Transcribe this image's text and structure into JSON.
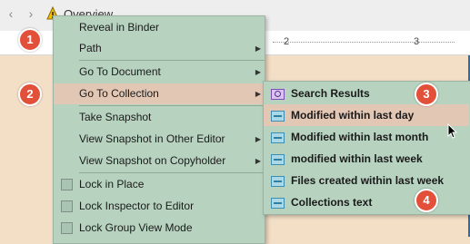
{
  "toolbar": {
    "back_glyph": "‹",
    "forward_glyph": "›",
    "document_title": "Overview"
  },
  "ruler": {
    "marks": [
      "2",
      "3"
    ]
  },
  "context_menu": {
    "items": [
      {
        "label": "Reveal in Binder"
      },
      {
        "label": "Path",
        "submenu": true
      },
      {
        "label": "Go To Document",
        "submenu": true
      },
      {
        "label": "Go To Collection",
        "submenu": true,
        "highlighted": true
      },
      {
        "label": "Take Snapshot"
      },
      {
        "label": "View Snapshot in Other Editor",
        "submenu": true
      },
      {
        "label": "View Snapshot on Copyholder",
        "submenu": true
      },
      {
        "label": "Lock in Place",
        "checkbox": true,
        "checked": false
      },
      {
        "label": "Lock Inspector to Editor",
        "checkbox": true,
        "checked": false
      },
      {
        "label": "Lock Group View Mode",
        "checkbox": true,
        "checked": false
      }
    ]
  },
  "collection_submenu": {
    "items": [
      {
        "label": "Search Results",
        "icon": "search-collection-icon"
      },
      {
        "label": "Modified within last day",
        "icon": "collection-icon",
        "highlighted": true
      },
      {
        "label": "Modified within last month",
        "icon": "collection-icon"
      },
      {
        "label": "modified within last week",
        "icon": "collection-icon"
      },
      {
        "label": "Files created within last week",
        "icon": "collection-icon"
      },
      {
        "label": "Collections text",
        "icon": "collection-icon"
      }
    ]
  },
  "annotations": [
    "1",
    "2",
    "3",
    "4"
  ],
  "colors": {
    "menu_bg": "#b7d3c0",
    "highlight": "#e3c7b5",
    "badge": "#e3503a",
    "editor_bg": "#f3dfc6"
  }
}
